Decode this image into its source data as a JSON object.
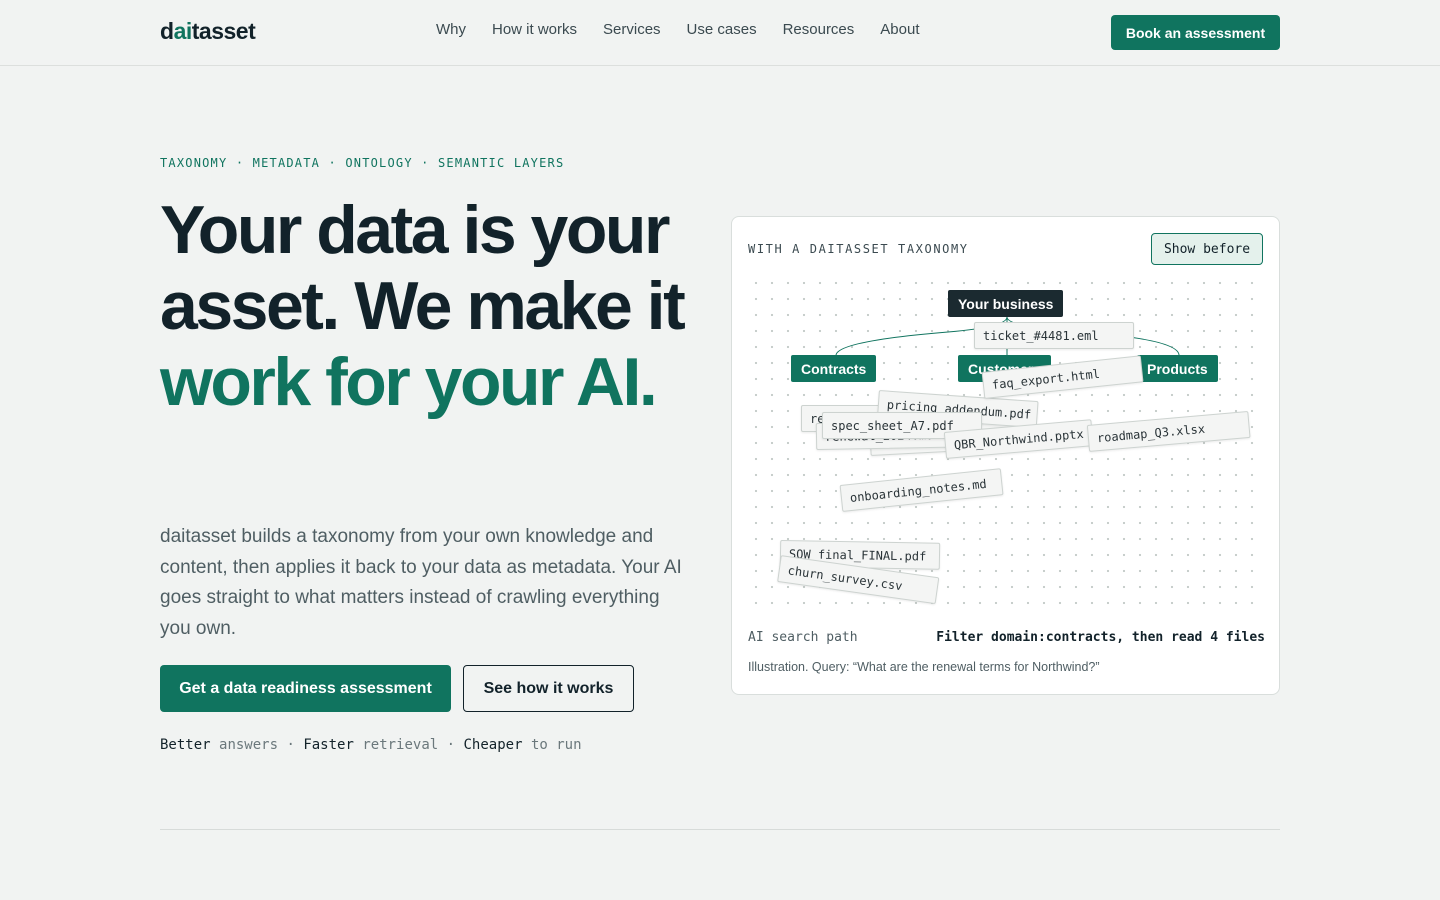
{
  "brand": {
    "prefix": "d",
    "accent": "ai",
    "suffix": "tasset",
    "accent_color": "#10745f"
  },
  "nav": {
    "links": [
      "Why",
      "How it works",
      "Services",
      "Use cases",
      "Resources",
      "About"
    ],
    "cta": "Book an assessment"
  },
  "hero": {
    "eyebrow": "TAXONOMY · METADATA · ONTOLOGY · SEMANTIC LAYERS",
    "headline_plain": "Your data is your asset. We make it ",
    "headline_highlight": "work for your AI.",
    "lead": "daitasset builds a taxonomy from your own knowledge and content, then applies it back to your data as metadata. Your AI goes straight to what matters instead of crawling everything you own.",
    "primary_cta": "Get a data readiness assessment",
    "secondary_cta": "See how it works",
    "benefits": [
      {
        "strong": "Better",
        "muted": "answers"
      },
      {
        "strong": "Faster",
        "muted": "retrieval"
      },
      {
        "strong": "Cheaper",
        "muted": "to run"
      }
    ],
    "benefit_separator": " · "
  },
  "card": {
    "label": "WITH A DAITASSET TAXONOMY",
    "toggle": "Show before",
    "root_node": "Your business",
    "categories": [
      "Contracts",
      "Customers",
      "Products"
    ],
    "files": [
      "ticket_#4481.eml",
      "faq_export.html",
      "pricing_addendum.pdf",
      "spec_sheet_A7.pdf",
      "renewal_2024.md",
      "QBR_Northwind.pptx",
      "roadmap_Q3.xlsx",
      "onboarding_notes.md",
      "SOW_final_FINAL.pdf",
      "churn_survey.csv"
    ],
    "path_label": "AI search path",
    "path_value": "Filter domain:contracts, then read 4 files",
    "caption": "Illustration. Query: “What are the renewal terms for Northwind?”"
  }
}
